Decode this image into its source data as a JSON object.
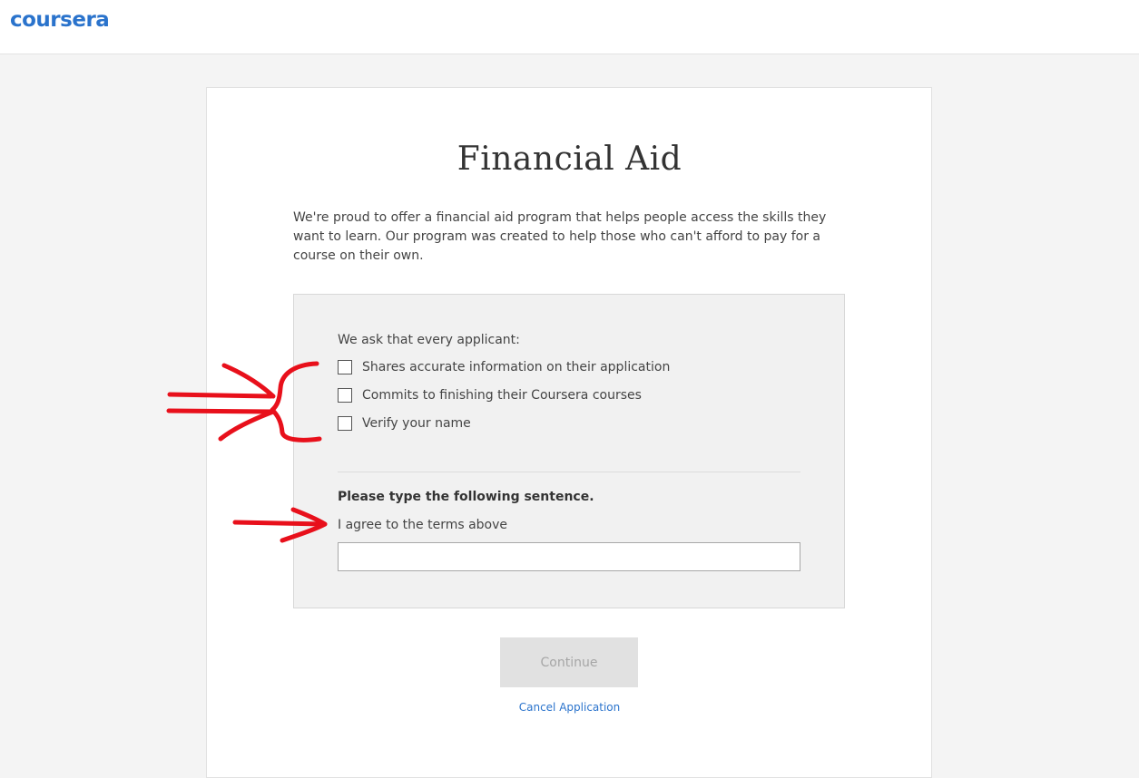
{
  "header": {
    "logo_text": "coursera",
    "brand_color": "#2a73cc"
  },
  "main": {
    "title": "Financial Aid",
    "intro": "We're proud to offer a financial aid program that helps people access the skills they want to learn. Our program was created to help those who can't afford to pay for a course on their own."
  },
  "requirements": {
    "label": "We ask that every applicant:",
    "items": [
      {
        "label": "Shares accurate information on their application",
        "checked": false
      },
      {
        "label": "Commits to finishing their Coursera courses",
        "checked": false
      },
      {
        "label": "Verify your name",
        "checked": false
      }
    ]
  },
  "agreement": {
    "instruction": "Please type the following sentence.",
    "sentence": "I agree to the terms above",
    "input_value": ""
  },
  "actions": {
    "continue_label": "Continue",
    "continue_disabled": true,
    "cancel_label": "Cancel Application"
  },
  "annotation_color": "#e8101b"
}
